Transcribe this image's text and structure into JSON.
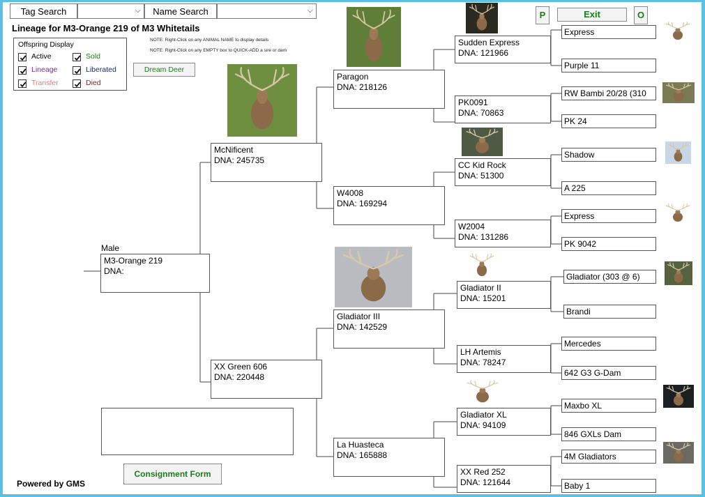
{
  "search": {
    "tag_label": "Tag Search",
    "name_label": "Name Search"
  },
  "title": "Lineage for M3-Orange 219 of M3 Whitetails",
  "notes": {
    "note1": "NOTE: Right-Click on any ANIMAL NAME to display details",
    "note2": "NOTE: Right-Click on any EMPTY box to QUICK-ADD a sire or dam"
  },
  "offspring": {
    "title": "Offspring Display",
    "items": [
      {
        "label": "Active",
        "color": "#000000",
        "checked": true
      },
      {
        "label": "Sold",
        "color": "#1e7a1e",
        "checked": true
      },
      {
        "label": "Lineage",
        "color": "#7b2a8c",
        "checked": true
      },
      {
        "label": "Liberated",
        "color": "#1a2a6b",
        "checked": true
      },
      {
        "label": "Transfer",
        "color": "#e07a7a",
        "checked": true
      },
      {
        "label": "Died",
        "color": "#8b1a1a",
        "checked": true
      }
    ]
  },
  "buttons": {
    "dream_deer": "Dream Deer",
    "p": "P",
    "exit": "Exit",
    "o": "O",
    "consignment": "Consignment Form"
  },
  "subject": {
    "sex": "Male",
    "name": "M3-Orange 219",
    "dna": "DNA:"
  },
  "sire": {
    "name": "McNificent",
    "dna": "DNA:  245735"
  },
  "dam": {
    "name": "XX Green 606",
    "dna": "DNA:  220448"
  },
  "gen3": {
    "paragon": {
      "name": "Paragon",
      "dna": "DNA:  218126"
    },
    "w4008": {
      "name": "W4008",
      "dna": "DNA:  169294"
    },
    "gladiator3": {
      "name": "Gladiator III",
      "dna": "DNA:  142529"
    },
    "lahuasteca": {
      "name": "La Huasteca",
      "dna": "DNA:  165888"
    }
  },
  "gen4": {
    "sudden": {
      "name": "Sudden Express",
      "dna": "DNA:  121966"
    },
    "pk0091": {
      "name": "PK0091",
      "dna": "DNA:  70863"
    },
    "cckid": {
      "name": "CC Kid Rock",
      "dna": "DNA:  51300"
    },
    "w2004": {
      "name": "W2004",
      "dna": "DNA:  131286"
    },
    "gladiator2": {
      "name": "Gladiator II",
      "dna": "DNA:  15201"
    },
    "artemis": {
      "name": "LH Artemis",
      "dna": "DNA:  78247"
    },
    "gladiatorxl": {
      "name": "Gladiator XL",
      "dna": "DNA:  94109"
    },
    "xxred": {
      "name": "XX Red 252",
      "dna": "DNA:  121644"
    }
  },
  "gen5": [
    "Express",
    "Purple 11",
    "RW Bambi 20/28 (310",
    "PK 24",
    "Shadow",
    "A 225",
    "Express",
    "PK 9042",
    "Gladiator (303 @ 6)",
    "Brandi",
    "Mercedes",
    "642 G3 G-Dam",
    "Maxbo XL",
    "846 GXLs Dam",
    "4M Gladiators",
    "Baby 1"
  ],
  "footer": "Powered by GMS",
  "colors": {
    "accent_green": "#1e7a1e",
    "page_border": "#5bc0e3"
  }
}
